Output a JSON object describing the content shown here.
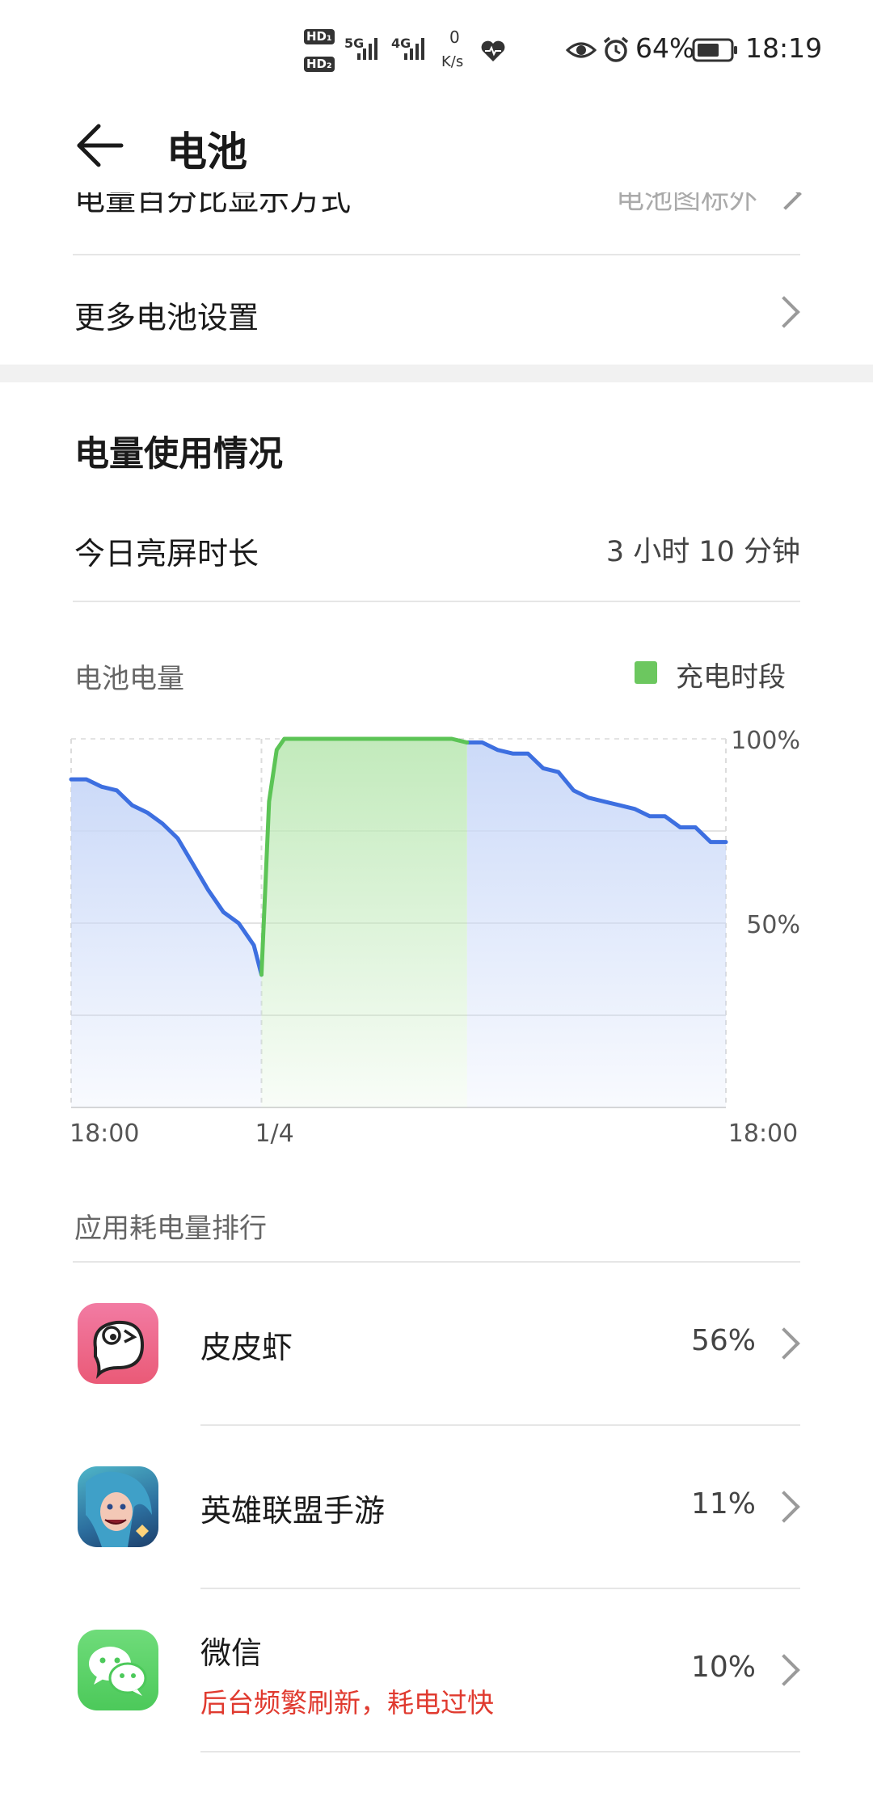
{
  "status_bar": {
    "hd1": "HD₁",
    "hd2": "HD₂",
    "net_5g": "5G",
    "net_4g": "4G",
    "speed_value": "0",
    "speed_unit": "K/s",
    "battery_pct": "64%",
    "time": "18:19"
  },
  "header": {
    "title": "电池"
  },
  "partial_row_label": "电量百分比显示方式",
  "partial_row_value": "电池图标外",
  "more_settings": {
    "label": "更多电池设置"
  },
  "usage": {
    "title": "电量使用情况",
    "screen_time_label": "今日亮屏时长",
    "screen_time_value": "3 小时 10 分钟",
    "battery_level_label": "电池电量",
    "legend_label": "充电时段"
  },
  "chart_data": {
    "type": "area",
    "series": [
      {
        "values": [
          [
            0,
            89
          ],
          [
            2,
            89
          ],
          [
            4,
            87
          ],
          [
            6,
            86
          ],
          [
            8,
            82
          ],
          [
            10,
            80
          ],
          [
            12,
            77
          ],
          [
            14,
            73
          ],
          [
            16,
            66
          ],
          [
            18,
            59
          ],
          [
            20,
            53
          ],
          [
            22,
            50
          ],
          [
            24,
            44
          ],
          [
            25,
            36
          ],
          [
            26,
            83
          ],
          [
            27,
            97
          ],
          [
            28,
            100
          ],
          [
            30,
            100
          ],
          [
            33,
            100
          ],
          [
            36,
            100
          ],
          [
            40,
            100
          ],
          [
            44,
            100
          ],
          [
            48,
            100
          ],
          [
            50,
            100
          ],
          [
            52,
            99
          ],
          [
            54,
            99
          ],
          [
            56,
            97
          ],
          [
            58,
            96
          ],
          [
            60,
            96
          ],
          [
            62,
            92
          ],
          [
            64,
            91
          ],
          [
            66,
            86
          ],
          [
            68,
            84
          ],
          [
            70,
            83
          ],
          [
            72,
            82
          ],
          [
            74,
            81
          ],
          [
            76,
            79
          ],
          [
            78,
            79
          ],
          [
            80,
            76
          ],
          [
            82,
            76
          ],
          [
            84,
            72
          ],
          [
            86,
            72
          ]
        ]
      }
    ],
    "charging_range": [
      25,
      52
    ],
    "ylim": [
      0,
      100
    ],
    "xlim": [
      0,
      86
    ],
    "y_ticks": [
      "100%",
      "50%"
    ],
    "x_ticks": [
      "18:00",
      "1/4",
      "18:00"
    ],
    "colors": {
      "line": "#3d6fe0",
      "fill": "#c9d8f8",
      "charge_line": "#5cc456",
      "charge_fill": "#bfe9b8"
    }
  },
  "app_ranking": {
    "title": "应用耗电量排行",
    "apps": [
      {
        "name": "皮皮虾",
        "percent": "56%"
      },
      {
        "name": "英雄联盟手游",
        "percent": "11%"
      },
      {
        "name": "微信",
        "percent": "10%",
        "warning": "后台频繁刷新，耗电过快"
      }
    ]
  }
}
